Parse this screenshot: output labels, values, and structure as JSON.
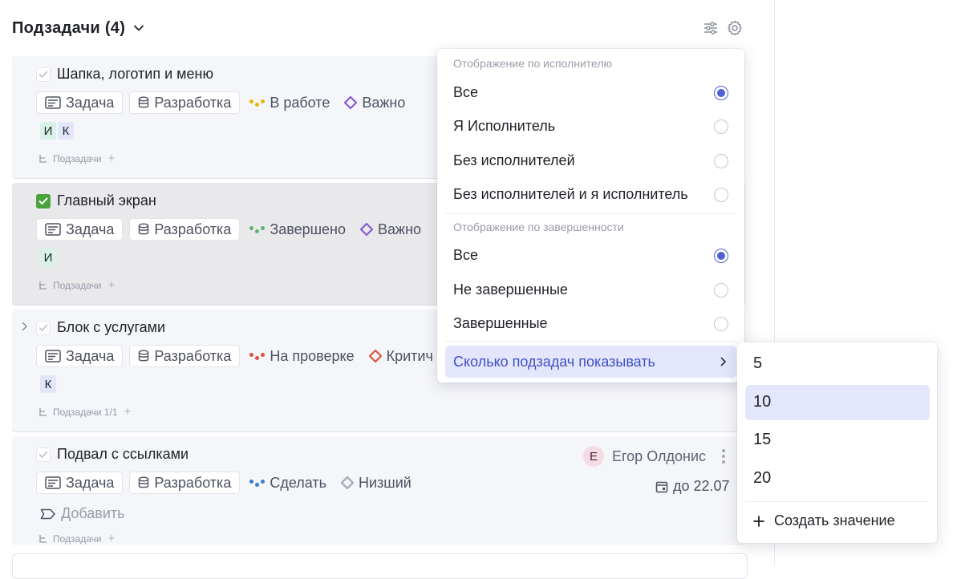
{
  "header": {
    "title": "Подзадачи (4)"
  },
  "tasks": [
    {
      "title": "Шапка, логотип и меню",
      "type": "Задача",
      "board": "Разработка",
      "status": "В работе",
      "priority": "Важно",
      "avatars": [
        "И",
        "К"
      ],
      "subtasks": "Подзадачи"
    },
    {
      "title": "Главный экран",
      "type": "Задача",
      "board": "Разработка",
      "status": "Завершено",
      "priority": "Важно",
      "avatars": [
        "И"
      ],
      "subtasks": "Подзадачи"
    },
    {
      "title": "Блок с услугами",
      "type": "Задача",
      "board": "Разработка",
      "status": "На проверке",
      "priority": "Критич",
      "avatars": [
        "К"
      ],
      "subtasks": "Подзадачи 1/1"
    },
    {
      "title": "Подвал с ссылками",
      "type": "Задача",
      "board": "Разработка",
      "status": "Сделать",
      "priority": "Низший",
      "owner_initial": "Е",
      "owner": "Егор Олдонис",
      "due": "до 22.07",
      "add_label": "Добавить",
      "subtasks": "Подзадачи"
    }
  ],
  "menu": {
    "section_assignee": "Отображение по исполнителю",
    "assignee_options": [
      "Все",
      "Я Исполнитель",
      "Без исполнителей",
      "Без исполнителей и я исполнитель"
    ],
    "assignee_selected": "Все",
    "section_done": "Отображение по завершенности",
    "done_options": [
      "Все",
      "Не завершенные",
      "Завершенные"
    ],
    "done_selected": "Все",
    "count_item": "Сколько подзадач показывать"
  },
  "submenu": {
    "values": [
      "5",
      "10",
      "15",
      "20"
    ],
    "selected": "10",
    "create_label": "Создать значение"
  },
  "colors": {
    "accent": "#4f5fd6",
    "done_check": "#4aa33b",
    "status_in_work": "#e8b400",
    "status_done": "#58b36a",
    "status_review": "#e0533f",
    "status_todo": "#3a7bd5",
    "priority_important": "#8a5cd1",
    "priority_critical": "#e0533f",
    "priority_low": "#a4a6b1"
  }
}
